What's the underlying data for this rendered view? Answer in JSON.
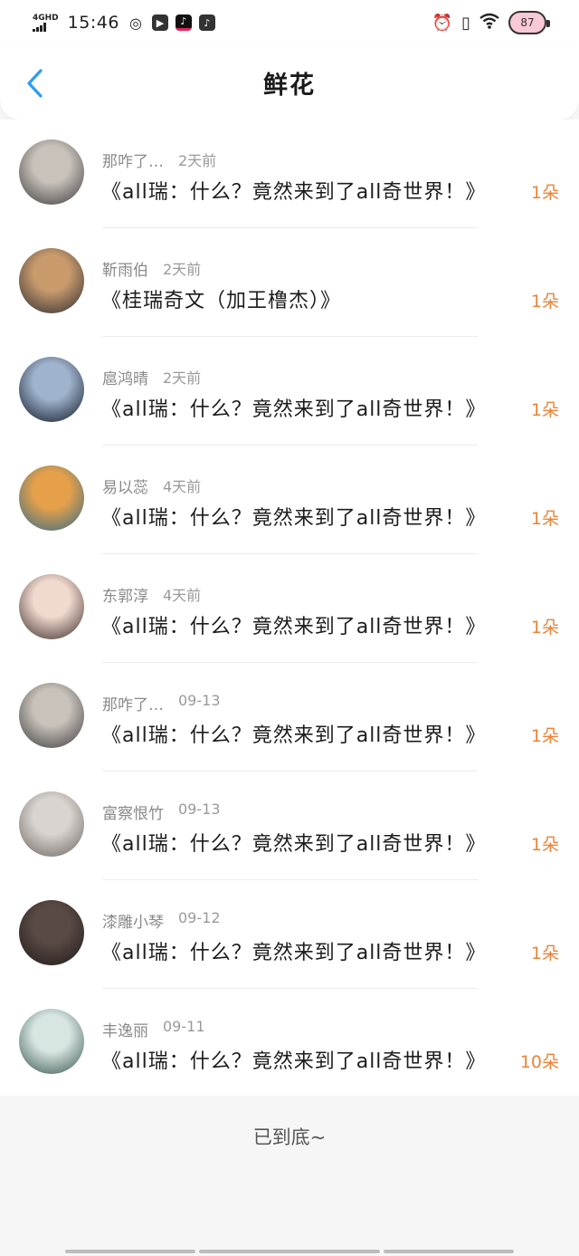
{
  "status_bar": {
    "network": "4GHD",
    "time": "15:46",
    "battery": "87",
    "icons": [
      "weibo-icon",
      "video-app-icon",
      "tiktok-icon",
      "tiktok-icon",
      "alarm-icon",
      "vibrate-icon",
      "wifi-icon"
    ]
  },
  "header": {
    "title": "鲜花",
    "back_icon": "chevron-left-icon",
    "accent": "#2a9df4"
  },
  "items": [
    {
      "user": "那咋了…",
      "time": "2天前",
      "book": "《all瑞：什么？竟然来到了all奇世界！》",
      "flowers": "1朵",
      "avatar_colors": [
        "#c9c2bb",
        "#3b3a3a"
      ]
    },
    {
      "user": "靳雨伯",
      "time": "2天前",
      "book": "《桂瑞奇文（加王橹杰）》",
      "flowers": "1朵",
      "avatar_colors": [
        "#c89a6c",
        "#2b2b33"
      ]
    },
    {
      "user": "扈鸿晴",
      "time": "2天前",
      "book": "《all瑞：什么？竟然来到了all奇世界！》",
      "flowers": "1朵",
      "avatar_colors": [
        "#9fb3cc",
        "#0d1424"
      ]
    },
    {
      "user": "易以蕊",
      "time": "4天前",
      "book": "《all瑞：什么？竟然来到了all奇世界！》",
      "flowers": "1朵",
      "avatar_colors": [
        "#e6a04a",
        "#2f6b8a"
      ]
    },
    {
      "user": "东郭淳",
      "time": "4天前",
      "book": "《all瑞：什么？竟然来到了all奇世界！》",
      "flowers": "1朵",
      "avatar_colors": [
        "#f0d9cf",
        "#3a2a26"
      ]
    },
    {
      "user": "那咋了…",
      "time": "09-13",
      "book": "《all瑞：什么？竟然来到了all奇世界！》",
      "flowers": "1朵",
      "avatar_colors": [
        "#c9c2bb",
        "#3b3a3a"
      ]
    },
    {
      "user": "富察恨竹",
      "time": "09-13",
      "book": "《all瑞：什么？竟然来到了all奇世界！》",
      "flowers": "1朵",
      "avatar_colors": [
        "#d9d4cf",
        "#6b6460"
      ]
    },
    {
      "user": "漆雕小琴",
      "time": "09-12",
      "book": "《all瑞：什么？竟然来到了all奇世界！》",
      "flowers": "1朵",
      "avatar_colors": [
        "#5a4a44",
        "#1e1a1a"
      ]
    },
    {
      "user": "丰逸丽",
      "time": "09-11",
      "book": "《all瑞：什么？竟然来到了all奇世界！》",
      "flowers": "10朵",
      "avatar_colors": [
        "#d8e6e2",
        "#35524e"
      ]
    }
  ],
  "footer": {
    "end_text": "已到底~"
  },
  "colors": {
    "flower_count": "#e8843a",
    "page_bg": "#f7f6f6"
  }
}
